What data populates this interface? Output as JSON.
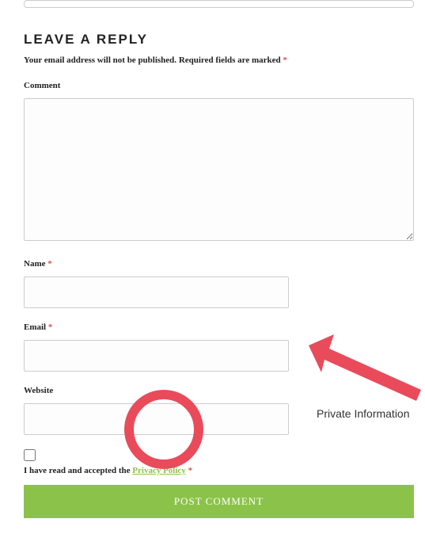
{
  "form": {
    "heading": "LEAVE A REPLY",
    "notice_prefix": "Your email address will not be published.",
    "notice_required": "Required fields are marked",
    "asterisk": "*",
    "comment_label": "Comment",
    "name_label": "Name",
    "email_label": "Email",
    "website_label": "Website",
    "privacy_text_before": "I have read and accepted the",
    "privacy_link_text": "Privacy Policy",
    "submit_label": "POST COMMENT"
  },
  "annotation": {
    "label": "Private Information"
  }
}
